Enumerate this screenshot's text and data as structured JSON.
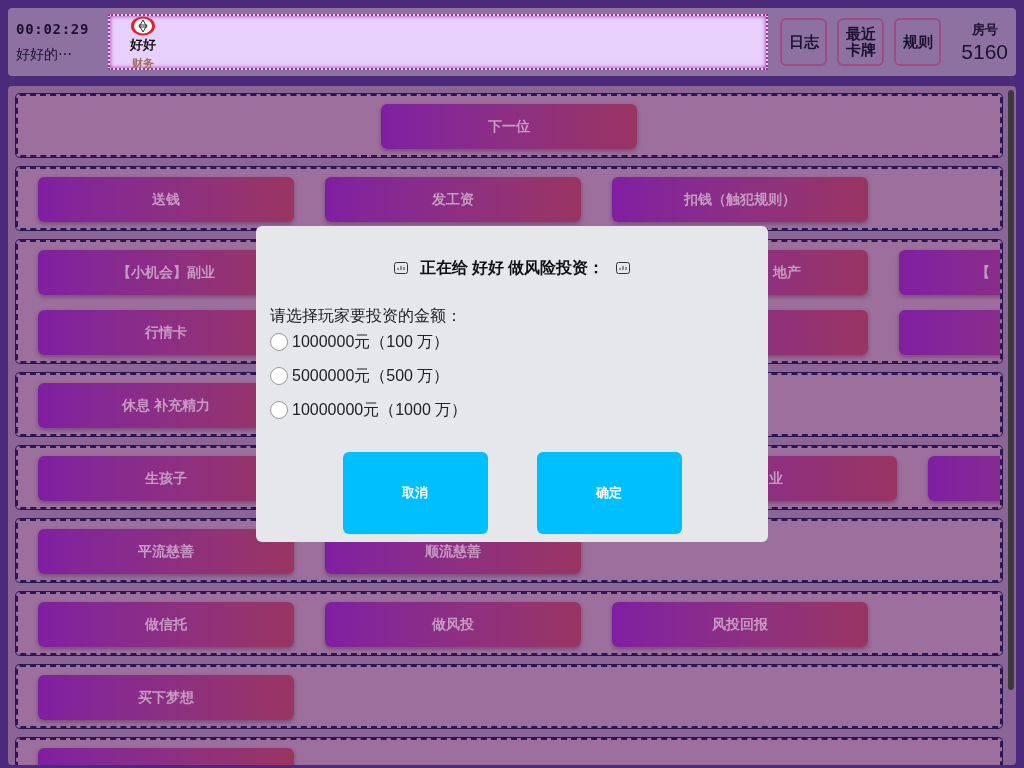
{
  "header": {
    "timer": "00:02:29",
    "subtitle": "好好的⋯",
    "players": [
      {
        "name": "好好",
        "role": "财务",
        "selected": true
      }
    ],
    "buttons": [
      "日志",
      "最近卡牌",
      "规则"
    ],
    "room_label": "房号",
    "room_number": "5160"
  },
  "sections": [
    {
      "kind": "centered",
      "lines": [
        [
          {
            "kind": "button",
            "label": "下一位"
          }
        ]
      ]
    },
    {
      "kind": "row",
      "lines": [
        [
          {
            "kind": "button",
            "label": "送钱"
          },
          {
            "kind": "button",
            "label": "发工资"
          },
          {
            "kind": "button",
            "label": "扣钱（触犯规则）"
          }
        ]
      ]
    },
    {
      "kind": "row",
      "lines": [
        [
          {
            "kind": "button",
            "label": "【小机会】副业"
          },
          {
            "kind": "spacer"
          },
          {
            "kind": "right_cut",
            "label": "地产"
          },
          {
            "kind": "left_cut",
            "label": "【"
          }
        ],
        [
          {
            "kind": "button",
            "label": "行情卡"
          },
          {
            "kind": "spacer"
          },
          {
            "kind": "button"
          },
          {
            "kind": "button"
          }
        ]
      ]
    },
    {
      "kind": "row",
      "lines": [
        [
          {
            "kind": "button",
            "label": "休息 补充精力"
          }
        ]
      ]
    },
    {
      "kind": "row",
      "lines": [
        [
          {
            "kind": "button",
            "label": "生孩子"
          },
          {
            "kind": "spacer"
          },
          {
            "kind": "wide_cut",
            "label": "业"
          },
          {
            "kind": "button"
          }
        ]
      ]
    },
    {
      "kind": "row",
      "lines": [
        [
          {
            "kind": "button",
            "label": "平流慈善"
          },
          {
            "kind": "button",
            "label": "顺流慈善"
          }
        ]
      ]
    },
    {
      "kind": "row",
      "lines": [
        [
          {
            "kind": "button",
            "label": "做信托"
          },
          {
            "kind": "button",
            "label": "做风投"
          },
          {
            "kind": "button",
            "label": "风投回报"
          }
        ]
      ]
    },
    {
      "kind": "row",
      "lines": [
        [
          {
            "kind": "button",
            "label": "买下梦想"
          }
        ]
      ]
    },
    {
      "kind": "row",
      "lines": [
        [
          {
            "kind": "button"
          }
        ]
      ]
    }
  ],
  "dialog": {
    "title": "正在给 好好 做风险投资：",
    "prompt": "请选择玩家要投资的金额：",
    "options": [
      {
        "label": "1000000元（100 万）",
        "selected": false
      },
      {
        "label": "5000000元（500 万）",
        "selected": false
      },
      {
        "label": "10000000元（1000 万）",
        "selected": false
      }
    ],
    "buttons": [
      "取消",
      "确定"
    ]
  }
}
